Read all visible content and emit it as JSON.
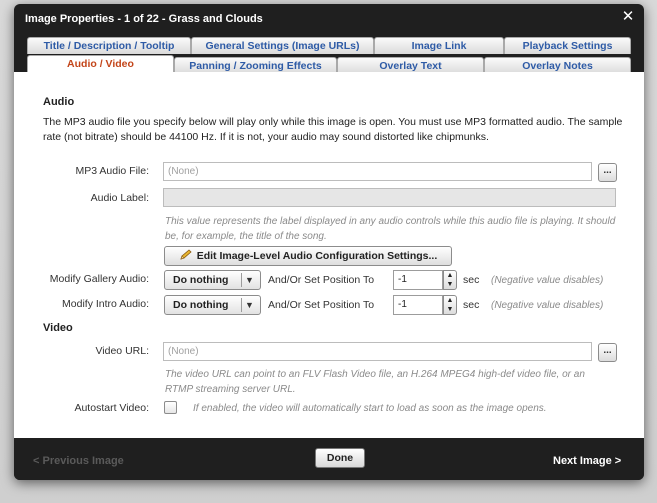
{
  "window": {
    "title": "Image Properties - 1 of 22 - Grass and Clouds",
    "close_icon": "close-icon"
  },
  "tabs": {
    "row1": [
      {
        "label": "Title / Description / Tooltip"
      },
      {
        "label": "General Settings (Image URLs)"
      },
      {
        "label": "Image Link"
      },
      {
        "label": "Playback Settings"
      }
    ],
    "row2": [
      {
        "label": "Audio / Video",
        "active": true
      },
      {
        "label": "Panning / Zooming Effects"
      },
      {
        "label": "Overlay Text"
      },
      {
        "label": "Overlay Notes"
      }
    ]
  },
  "audio": {
    "heading": "Audio",
    "description": "The MP3 audio file you specify below will play only while this image is open.  You must use MP3 formatted audio.  The sample rate (not bitrate) should be 44100 Hz.  If it is not, your audio may sound distorted like chipmunks.",
    "mp3_label": "MP3 Audio File:",
    "mp3_placeholder": "(None)",
    "browse_label": "...",
    "audio_label_label": "Audio Label:",
    "audio_label_value": "",
    "audio_label_hint": "This value represents the label displayed in any audio controls while this audio file is playing.  It should be, for example, the title of the song.",
    "edit_button": "Edit Image-Level Audio Configuration Settings...",
    "gallery_label": "Modify Gallery Audio:",
    "gallery_select": "Do nothing",
    "gallery_position_label": "And/Or Set Position To",
    "gallery_position_value": "-1",
    "gallery_unit": "sec",
    "gallery_hint": "(Negative value disables)",
    "intro_label": "Modify Intro Audio:",
    "intro_select": "Do nothing",
    "intro_position_label": "And/Or Set Position To",
    "intro_position_value": "-1",
    "intro_unit": "sec",
    "intro_hint": "(Negative value disables)"
  },
  "video": {
    "heading": "Video",
    "url_label": "Video URL:",
    "url_placeholder": "(None)",
    "browse_label": "...",
    "url_hint": "The video URL can point to an FLV Flash Video file, an H.264 MPEG4 high-def video file, or an RTMP streaming server URL.",
    "autostart_label": "Autostart Video:",
    "autostart_checked": false,
    "autostart_hint": "If enabled, the video will automatically start to load as soon as the image opens."
  },
  "footer": {
    "prev_label": "< Previous Image",
    "done_label": "Done",
    "next_label": "Next Image >"
  },
  "colors": {
    "active_tab_text": "#c3451a",
    "tab_text": "#2e5ba6",
    "dialog_frame": "#1f1f1f"
  }
}
